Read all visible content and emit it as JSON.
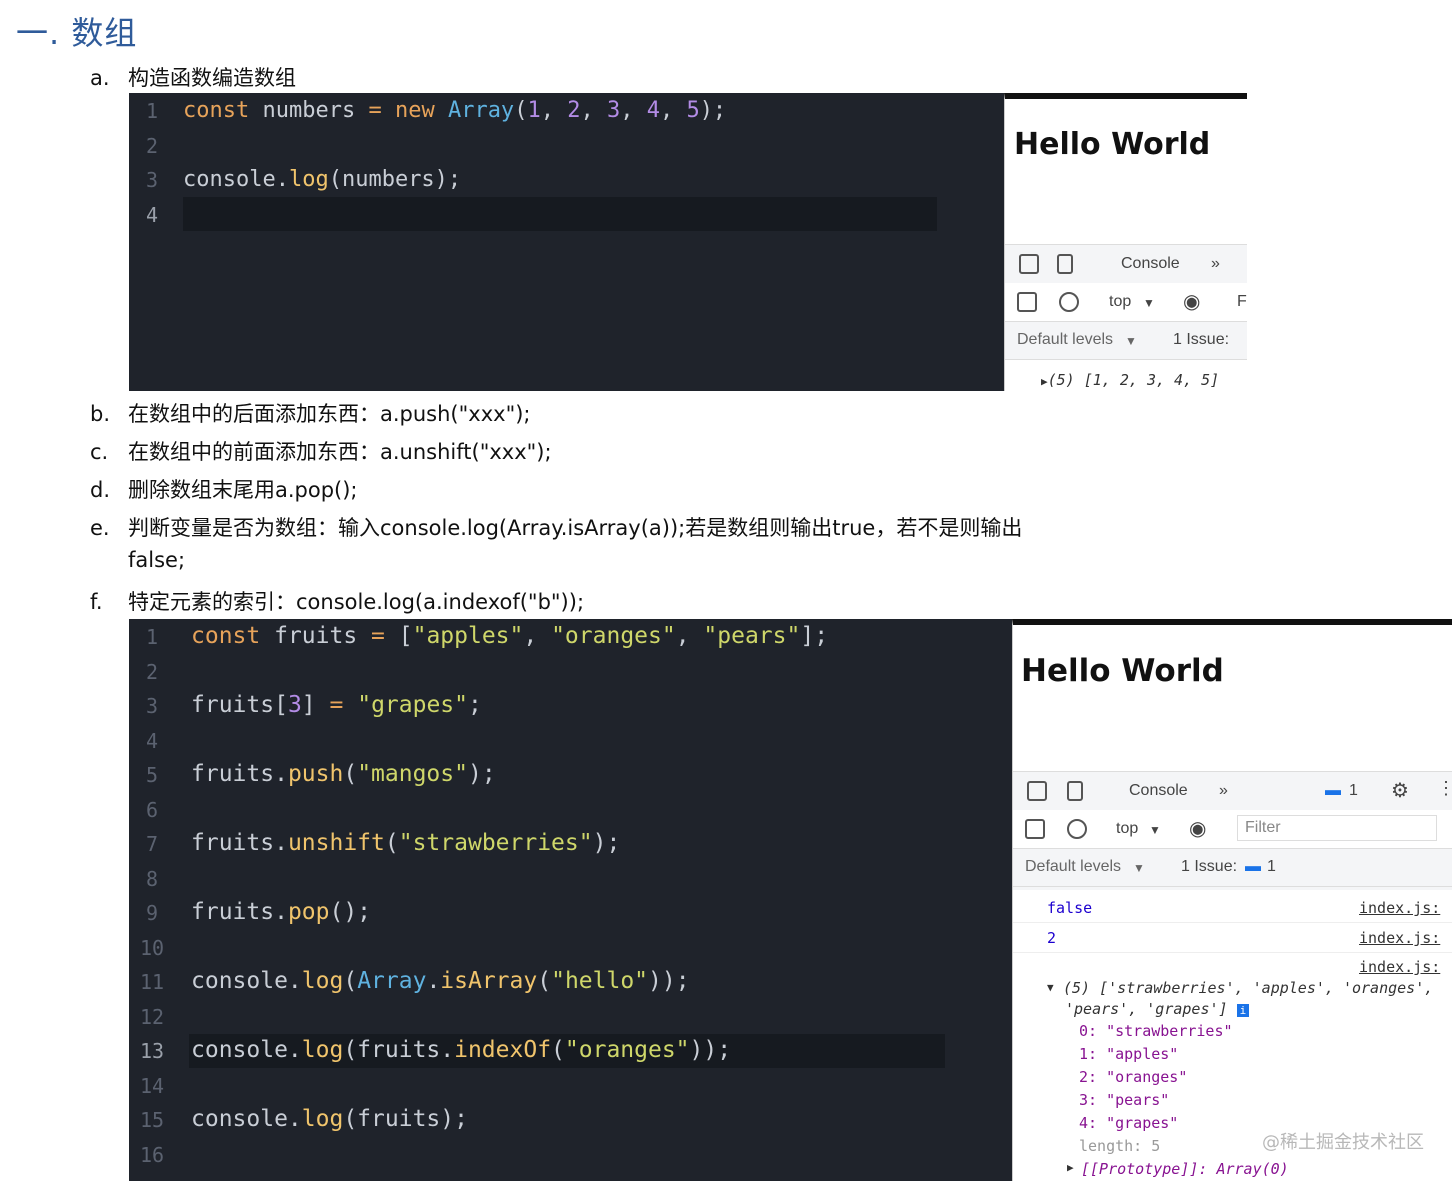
{
  "heading": "一. 数组",
  "items": [
    {
      "marker": "a.",
      "text": "构造函数编造数组"
    },
    {
      "marker": "b.",
      "text": "在数组中的后面添加东西：a.push(\"xxx\");"
    },
    {
      "marker": "c.",
      "text": "在数组中的前面添加东西：a.unshift(\"xxx\");"
    },
    {
      "marker": "d.",
      "text": "删除数组末尾用a.pop();"
    },
    {
      "marker": "e.",
      "text": "判断变量是否为数组：输入console.log(Array.isArray(a));若是数组则输出true，若不是则输出",
      "text2": "false;"
    },
    {
      "marker": "f.",
      "text": "特定元素的索引：console.log(a.indexof(\"b\"));"
    }
  ],
  "shot1": {
    "line_numbers": [
      "1",
      "2",
      "3",
      "4"
    ],
    "panel": {
      "title": "Hello World",
      "tab": "Console",
      "more": "»",
      "context": "top",
      "filter": "Fi",
      "levels": "Default levels",
      "issues": "1 Issue:",
      "output": "(5) [1, 2, 3, 4, 5]"
    }
  },
  "shot2": {
    "line_numbers": [
      "1",
      "2",
      "3",
      "4",
      "5",
      "6",
      "7",
      "8",
      "9",
      "10",
      "11",
      "12",
      "13",
      "14",
      "15",
      "16"
    ],
    "panel": {
      "title": "Hello World",
      "tab": "Console",
      "more": "»",
      "badge": "1",
      "context": "top",
      "filter": "Filter",
      "levels": "Default levels",
      "issues": "1 Issue:",
      "issues_count": "1",
      "logs": [
        {
          "value": "false",
          "source": "index.js:"
        },
        {
          "value": "2",
          "source": "index.js:"
        }
      ],
      "array_source": "index.js:",
      "array_summary_1": "(5) ['strawberries', 'apples', 'oranges',",
      "array_summary_2": "'pears', 'grapes']",
      "entries": [
        "0: \"strawberries\"",
        "1: \"apples\"",
        "2: \"oranges\"",
        "3: \"pears\"",
        "4: \"grapes\""
      ],
      "length": "length: 5",
      "proto": "[[Prototype]]: Array(0)"
    }
  },
  "watermark": "@稀土掘金技术社区"
}
